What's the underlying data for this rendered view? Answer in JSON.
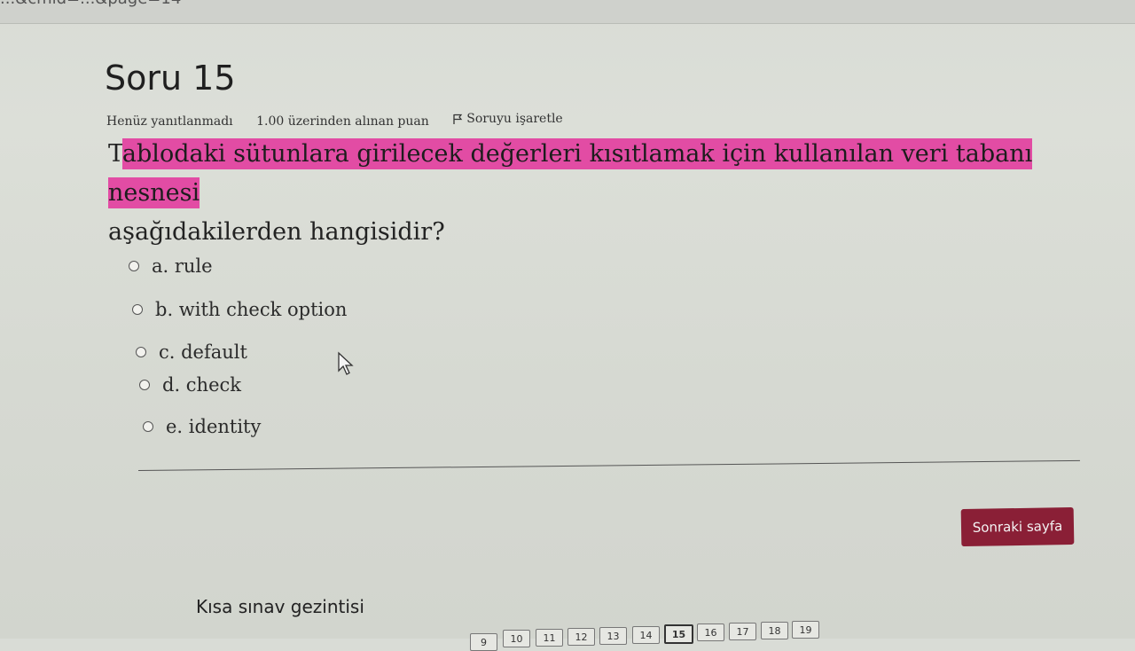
{
  "browser": {
    "url_fragment": "...&cmid=...&page=14"
  },
  "question": {
    "title": "Soru 15",
    "status": "Henüz yanıtlanmadı",
    "points": "1.00 üzerinden alınan puan",
    "flag_label": "Soruyu işaretle",
    "text_first_letter": "T",
    "text_highlighted": "ablodaki sütunlara girilecek değerleri kısıtlamak için kullanılan veri tabanı nesnesi",
    "text_rest": "aşağıdakilerden hangisidir?"
  },
  "options": [
    {
      "label": "a. rule"
    },
    {
      "label": "b. with check option"
    },
    {
      "label": "c. default"
    },
    {
      "label": "d. check"
    },
    {
      "label": "e. identity"
    }
  ],
  "next_button": "Sonraki sayfa",
  "quiz_nav": {
    "title": "Kısa sınav gezintisi",
    "pages": [
      "9",
      "10",
      "11",
      "12",
      "13",
      "14",
      "15",
      "16",
      "17",
      "18",
      "19"
    ],
    "current": "15"
  },
  "colors": {
    "highlight": "#e24ca4",
    "button": "#8a1f36"
  },
  "icons": {
    "flag": "flag-icon",
    "cursor": "mouse-cursor-icon"
  }
}
